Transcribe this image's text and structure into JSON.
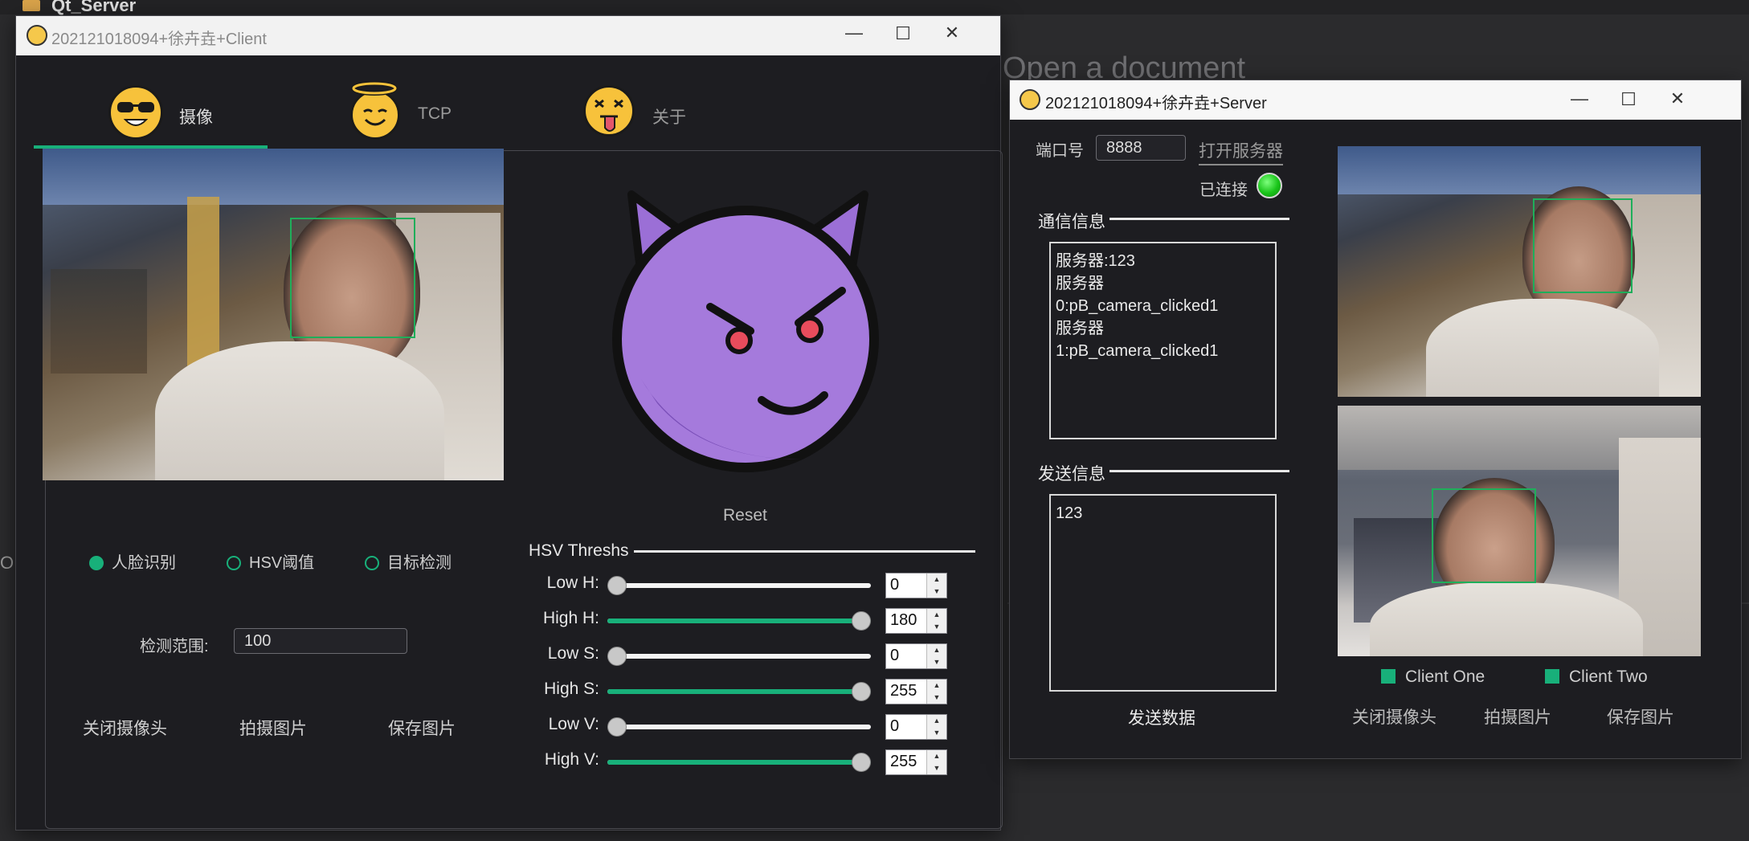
{
  "background": {
    "ide_title": "Qt_Server",
    "ide_text": "Open a document",
    "ide_left": "O"
  },
  "client": {
    "title": "202121018094+徐卉垚+Client",
    "controls": {
      "min": "—",
      "max": "☐",
      "close": "✕"
    },
    "tabs": [
      {
        "label": "摄像",
        "icon": "cool-sunglasses-emoji-icon",
        "active": true
      },
      {
        "label": "TCP",
        "icon": "angel-halo-emoji-icon",
        "active": false
      },
      {
        "label": "关于",
        "icon": "tongue-out-emoji-icon",
        "active": false
      }
    ],
    "devil_icon": "devil-emoji-icon",
    "reset_label": "Reset",
    "modes": [
      {
        "label": "人脸识别",
        "checked": true
      },
      {
        "label": "HSV阈值",
        "checked": false
      },
      {
        "label": "目标检测",
        "checked": false
      }
    ],
    "range_label": "检测范围:",
    "range_value": "100",
    "buttons": {
      "close_camera": "关闭摄像头",
      "capture": "拍摄图片",
      "save": "保存图片"
    },
    "hsv": {
      "title": "HSV Threshs",
      "sliders": [
        {
          "label": "Low H:",
          "value": "0",
          "fraction": 0
        },
        {
          "label": "High H:",
          "value": "180",
          "fraction": 1
        },
        {
          "label": "Low S:",
          "value": "0",
          "fraction": 0
        },
        {
          "label": "High S:",
          "value": "255",
          "fraction": 1
        },
        {
          "label": "Low V:",
          "value": "0",
          "fraction": 0
        },
        {
          "label": "High V:",
          "value": "255",
          "fraction": 1
        }
      ]
    }
  },
  "server": {
    "title": "202121018094+徐卉垚+Server",
    "controls": {
      "min": "—",
      "max": "☐",
      "close": "✕"
    },
    "port_label": "端口号",
    "port_value": "8888",
    "open_server_label": "打开服务器",
    "status_label": "已连接",
    "comm_section": "通信信息",
    "comm_lines": [
      "服务器:123",
      "服务器",
      "0:pB_camera_clicked1",
      "服务器",
      "1:pB_camera_clicked1"
    ],
    "send_section": "发送信息",
    "send_text": "123",
    "send_button": "发送数据",
    "legend": [
      "Client One",
      "Client Two"
    ],
    "buttons": {
      "close_camera": "关闭摄像头",
      "capture": "拍摄图片",
      "save": "保存图片"
    }
  },
  "colors": {
    "accent": "#18b07a",
    "window_bg": "#1d1d21",
    "status_on": "#19c419"
  }
}
